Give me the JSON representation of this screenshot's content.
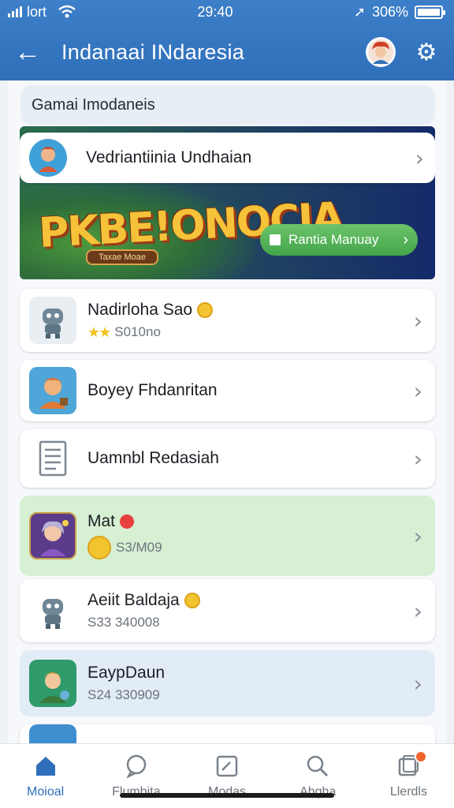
{
  "status_bar": {
    "carrier": "lort",
    "time": "29:40",
    "battery_percent": "306%"
  },
  "app_bar": {
    "title": "Indanaai INdaresia",
    "back_icon": "arrow-left-icon",
    "settings_icon": "gear-icon"
  },
  "section": {
    "label": "Gamai Imodaneis"
  },
  "featured": {
    "card_label": "Vedriantiinia Undhaian",
    "logo_text": "PKBE!ONOCIA",
    "logo_tag": "Taxae Moae",
    "play_button": "Rantia Manuay"
  },
  "list": [
    {
      "name": "Nadirloha Sao",
      "sub": "S010no",
      "stars": 2,
      "has_coin": true,
      "style": "white"
    },
    {
      "name": "Boyey Fhdanritan",
      "sub": "",
      "style": "white"
    },
    {
      "name": "Uamnbl Redasiah",
      "sub": "",
      "style": "white"
    },
    {
      "name": "Mat",
      "sub": "S3/M09",
      "has_dot": true,
      "style": "green"
    },
    {
      "name": "Aeiit Baldaja",
      "sub": "S33 340008",
      "has_coin": true,
      "style": "white"
    },
    {
      "name": "EaypDaun",
      "sub": "S24 330909",
      "style": "blue"
    }
  ],
  "bottom_nav": [
    {
      "label": "Moioal",
      "icon": "home-icon",
      "active": true
    },
    {
      "label": "Flumbita",
      "icon": "chat-icon"
    },
    {
      "label": "Modas",
      "icon": "mode-icon"
    },
    {
      "label": "Ahgha",
      "icon": "search-icon"
    },
    {
      "label": "Llerdls",
      "icon": "notes-icon",
      "badge": true
    }
  ],
  "colors": {
    "app_bar": "#3d7fc9",
    "accent": "#2f6fb9",
    "play_button": "#4fad50",
    "highlight_green": "#d7efd3",
    "highlight_blue": "#e2ecf7"
  }
}
